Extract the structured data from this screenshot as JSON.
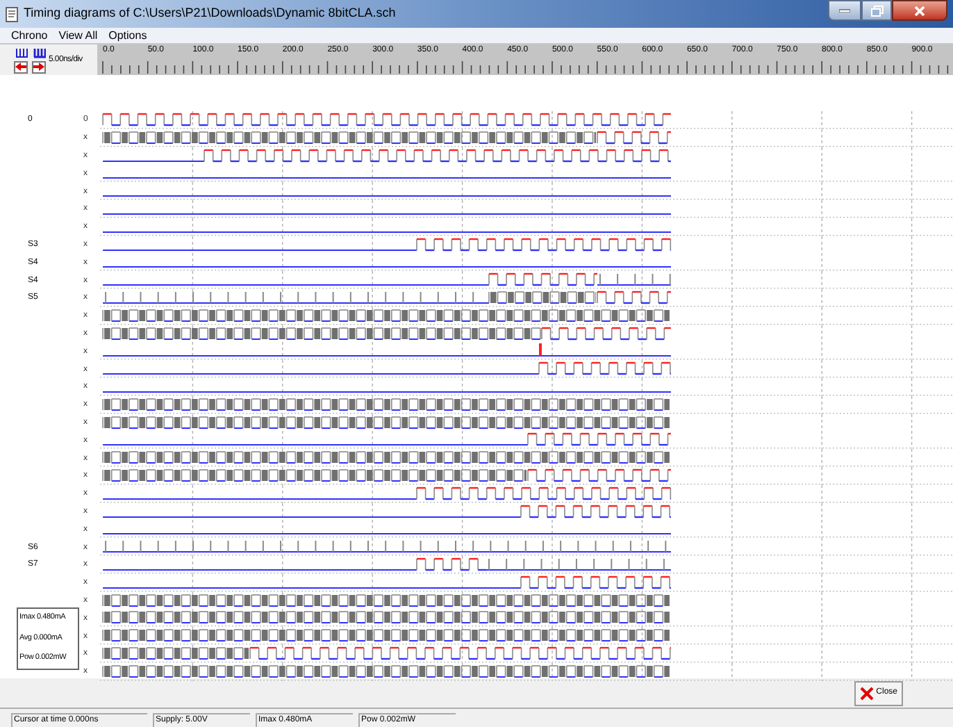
{
  "window": {
    "title": "Timing diagrams of C:\\Users\\P21\\Downloads\\Dynamic 8bitCLA.sch"
  },
  "menu": [
    "Chrono",
    "View All",
    "Options"
  ],
  "toolbar": {
    "scale": "5.00ns/div"
  },
  "ruler": {
    "labels": [
      "0.0",
      "50.0",
      "100.0",
      "150.0",
      "200.0",
      "250.0",
      "300.0",
      "350.0",
      "400.0",
      "450.0",
      "500.0",
      "550.0",
      "600.0",
      "650.0",
      "700.0",
      "750.0",
      "800.0",
      "850.0",
      "900.0"
    ]
  },
  "signals": [
    {
      "name": "0",
      "value": "0",
      "kind": "clock"
    },
    {
      "value": "x",
      "kind": "bus_clock"
    },
    {
      "value": "x",
      "kind": "low_clock"
    },
    {
      "value": "x",
      "kind": "low"
    },
    {
      "value": "x",
      "kind": "low"
    },
    {
      "value": "x",
      "kind": "low"
    },
    {
      "value": "x",
      "kind": "low"
    },
    {
      "name": "S3",
      "value": "x",
      "kind": "low_clock"
    },
    {
      "name": "S4",
      "value": "x",
      "kind": "low"
    },
    {
      "name": "S4",
      "value": "x",
      "kind": "burst"
    },
    {
      "name": "S5",
      "value": "x",
      "kind": "ticks_bus_clock"
    },
    {
      "value": "x",
      "kind": "bus"
    },
    {
      "value": "x",
      "kind": "bus_clock"
    },
    {
      "value": "x",
      "kind": "glitch"
    },
    {
      "value": "x",
      "kind": "low_clock"
    },
    {
      "value": "x",
      "kind": "low"
    },
    {
      "value": "x",
      "kind": "bus"
    },
    {
      "value": "x",
      "kind": "bus"
    },
    {
      "value": "x",
      "kind": "low_clock"
    },
    {
      "value": "x",
      "kind": "bus"
    },
    {
      "value": "x",
      "kind": "bus_clock"
    },
    {
      "value": "x",
      "kind": "low_clock"
    },
    {
      "value": "x",
      "kind": "low_clock"
    },
    {
      "value": "x",
      "kind": "low"
    },
    {
      "name": "S6",
      "value": "x",
      "kind": "ticks"
    },
    {
      "name": "S7",
      "value": "x",
      "kind": "burst"
    },
    {
      "value": "x",
      "kind": "low_clock"
    },
    {
      "value": "x",
      "kind": "bus"
    },
    {
      "value": "x",
      "kind": "bus"
    },
    {
      "value": "x",
      "kind": "bus"
    },
    {
      "value": "x",
      "kind": "bus_clock"
    },
    {
      "value": "x",
      "kind": "bus"
    }
  ],
  "measurements": [
    "Imax 0.480mA",
    "Avg 0.000mA",
    "Pow 0.002mW"
  ],
  "close_button": "Close",
  "status_bar": [
    "Cursor at time 0.000ns",
    "Supply: 5.00V",
    "Imax 0.480mA",
    "Pow 0.002mW"
  ]
}
